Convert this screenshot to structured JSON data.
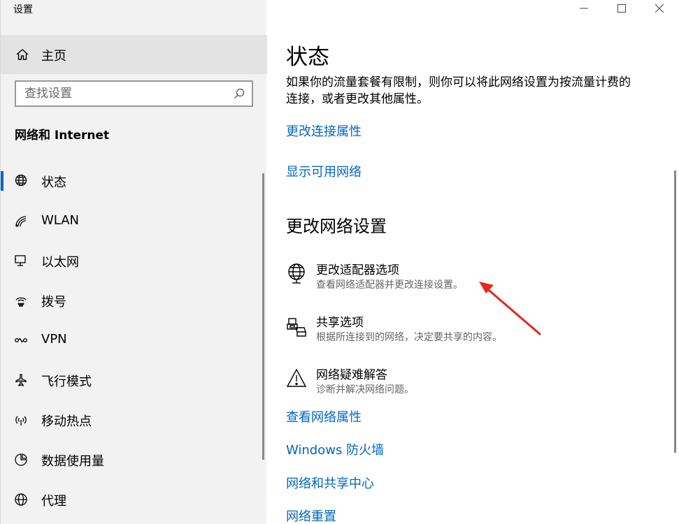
{
  "app": {
    "title": "设置"
  },
  "window_controls": {
    "minimize": "—",
    "maximize": "☐",
    "close": "✕"
  },
  "sidebar": {
    "home": {
      "label": "主页",
      "icon": "home-icon"
    },
    "search": {
      "placeholder": "查找设置",
      "value": "",
      "icon": "search-icon"
    },
    "section_title": "网络和 Internet",
    "items": [
      {
        "label": "状态",
        "icon": "globe-status-icon",
        "active": true
      },
      {
        "label": "WLAN",
        "icon": "wifi-icon",
        "active": false
      },
      {
        "label": "以太网",
        "icon": "ethernet-icon",
        "active": false
      },
      {
        "label": "拨号",
        "icon": "dialup-icon",
        "active": false
      },
      {
        "label": "VPN",
        "icon": "vpn-icon",
        "active": false
      },
      {
        "label": "飞行模式",
        "icon": "airplane-icon",
        "active": false
      },
      {
        "label": "移动热点",
        "icon": "hotspot-icon",
        "active": false
      },
      {
        "label": "数据使用量",
        "icon": "data-usage-icon",
        "active": false
      },
      {
        "label": "代理",
        "icon": "proxy-globe-icon",
        "active": false
      }
    ]
  },
  "main": {
    "title": "状态",
    "description": "如果你的流量套餐有限制，则你可以将此网络设置为按流量计费的连接，或者更改其他属性。",
    "links_top": [
      {
        "label": "更改连接属性"
      },
      {
        "label": "显示可用网络"
      }
    ],
    "change_settings_header": "更改网络设置",
    "options": [
      {
        "title": "更改适配器选项",
        "subtitle": "查看网络适配器并更改连接设置。",
        "icon": "adapter-globe-icon"
      },
      {
        "title": "共享选项",
        "subtitle": "根据所连接到的网络，决定要共享的内容。",
        "icon": "sharing-icon"
      },
      {
        "title": "网络疑难解答",
        "subtitle": "诊断并解决网络问题。",
        "icon": "warning-icon"
      }
    ],
    "links_bottom": [
      {
        "label": "查看网络属性"
      },
      {
        "label": "Windows 防火墙"
      },
      {
        "label": "网络和共享中心"
      },
      {
        "label": "网络重置"
      }
    ]
  },
  "colors": {
    "accent": "#0067c0",
    "sidebar_bg": "#f2f2f2",
    "home_bg": "#e3e3e3",
    "annotation_arrow": "#e8261e"
  }
}
